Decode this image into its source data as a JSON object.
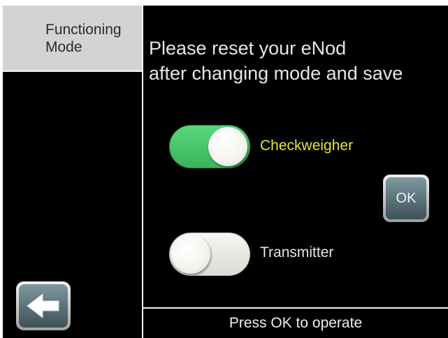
{
  "sidebar": {
    "tab_label": "Functioning\nMode"
  },
  "main": {
    "message": "Please reset your eNod\nafter changing mode and save",
    "options": [
      {
        "label": "Checkweigher",
        "state": "on",
        "color": "#e8e23d"
      },
      {
        "label": "Transmitter",
        "state": "off",
        "color": "#e6e6e6"
      }
    ],
    "ok_label": "OK"
  },
  "footer": {
    "status": "Press OK to operate"
  },
  "colors": {
    "background": "#000000",
    "toggle_on": "#4cc76c",
    "toggle_off": "#ececea",
    "tab_background": "#d3d3d3",
    "button_face": "#5b7078"
  },
  "icons": {
    "back": "arrow-left-icon"
  }
}
